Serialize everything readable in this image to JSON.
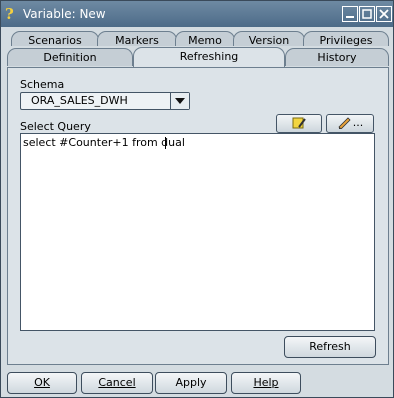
{
  "window": {
    "title": "Variable: New"
  },
  "tabs": {
    "back_row": [
      "Scenarios",
      "Markers",
      "Memo",
      "Version",
      "Privileges"
    ],
    "front_row": [
      "Definition",
      "Refreshing",
      "History"
    ],
    "active": "Refreshing"
  },
  "refreshing": {
    "schema_label": "Schema",
    "schema_value": "ORA_SALES_DWH",
    "query_label": "Select Query",
    "query_text": "select #Counter+1 from dual",
    "edit_button": "...",
    "refresh_button": "Refresh"
  },
  "footer": {
    "ok": "OK",
    "cancel": "Cancel",
    "apply": "Apply",
    "help": "Help"
  }
}
